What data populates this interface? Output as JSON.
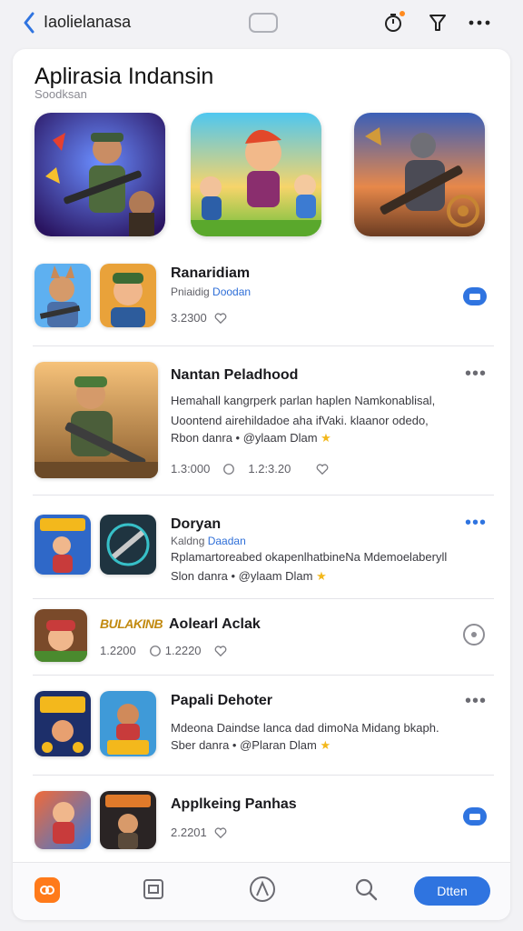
{
  "topbar": {
    "title": "Iaolielanasa",
    "back_icon": "chevron-left-icon",
    "icons": [
      "timer-icon",
      "filter-icon",
      "more-icon"
    ]
  },
  "header": {
    "title": "Aplirasia Indansin",
    "subtitle": "Soodksan"
  },
  "featured": [
    {
      "icon": "soldier-game-art"
    },
    {
      "icon": "cartoon-heroes-game-art"
    },
    {
      "icon": "armored-soldier-game-art"
    }
  ],
  "rows": [
    {
      "title": "Ranaridiam",
      "sub_prefix": "Pniaidig ",
      "sub_link": "Doodan",
      "meta": "3.2300"
    },
    {
      "title": "Nantan Peladhood",
      "desc_lines": [
        "Hemahall kangrperk parlan haplen Namkonablisal,",
        "Uoontend airehildadoe aha ifVaki. klaanor odedo,"
      ],
      "tag": "Rbon danra • @ylaam Dlam",
      "meta_a": "1.3:000",
      "meta_b": "1.2:3.20"
    },
    {
      "title": "Doryan",
      "sub_prefix": "Kaldng ",
      "sub_link": "Daadan",
      "desc_lines": [
        "Rplamartoreabed okapenlhatbineNa Mdemoelaberyll"
      ],
      "tag": "Slon danra • @ylaam Dlam"
    },
    {
      "title_badge": "BULAKINB",
      "title": "Aolearl Aclak",
      "meta_a": "1.2200",
      "meta_b": "1.2220"
    },
    {
      "title": "Papali Dehoter",
      "desc_lines": [
        "Mdeona Daindse lanca dad dimoNa Midang bkaph."
      ],
      "tag": "Sber danra • @Plaran Dlam"
    },
    {
      "title": "Applkeing Panhas",
      "meta": "2.2201"
    }
  ],
  "bottom_nav": {
    "items": [
      "home-icon",
      "apps-icon",
      "store-icon",
      "search-icon"
    ],
    "open_label": "Dtten"
  },
  "colors": {
    "accent": "#2f74e0",
    "orange": "#ff7a1a",
    "star": "#f3b81c"
  }
}
